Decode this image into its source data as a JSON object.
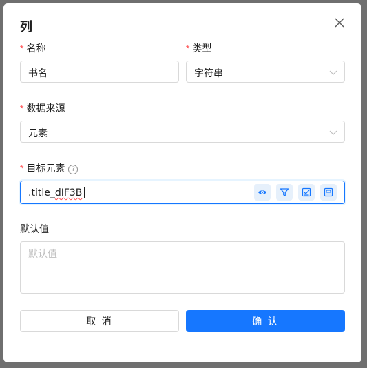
{
  "dialog": {
    "title": "列",
    "required_mark": "*",
    "name": {
      "label": "名称",
      "value": "书名"
    },
    "type": {
      "label": "类型",
      "value": "字符串"
    },
    "source": {
      "label": "数据来源",
      "value": "元素"
    },
    "target": {
      "label": "目标元素",
      "help": "?",
      "value_prefix": ".title_",
      "value_misspelled": "dIF3B",
      "tools": [
        "eye-icon",
        "filter-icon",
        "select-check-icon",
        "element-picker-icon"
      ]
    },
    "default": {
      "label": "默认值",
      "placeholder": "默认值"
    },
    "cancel_label": "取 消",
    "ok_label": "确 认"
  },
  "colors": {
    "accent": "#1677ff",
    "required": "#ff4d4f",
    "border": "#d9d9d9",
    "tool_bg": "#e6f0fb"
  }
}
